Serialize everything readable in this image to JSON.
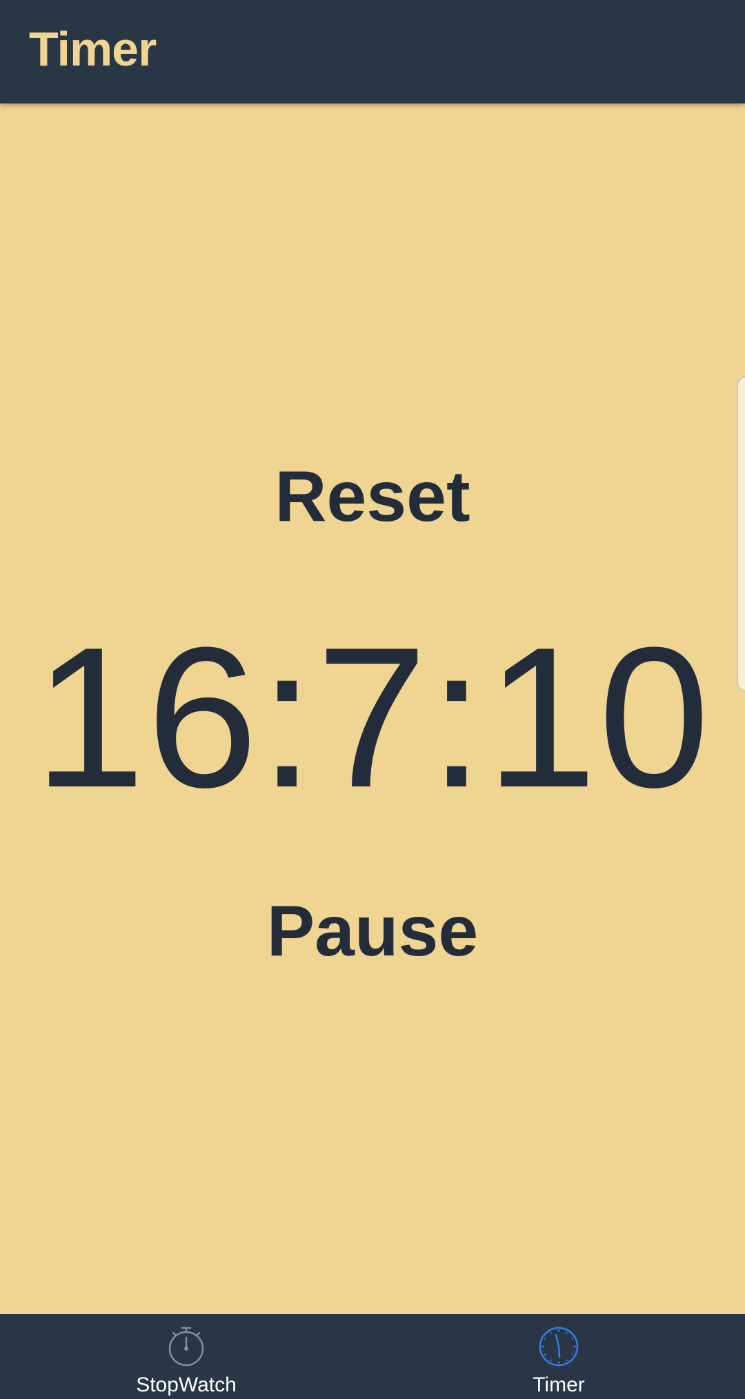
{
  "app_bar": {
    "title": "Timer",
    "background_color": "#283645",
    "title_color": "#f0d491"
  },
  "main": {
    "background_color": "#f0d491",
    "text_color": "#222c3a",
    "reset_label": "Reset",
    "time_display": "16:7:10",
    "pause_label": "Pause"
  },
  "bottom_nav": {
    "items": [
      {
        "label": "StopWatch",
        "icon": "stopwatch-icon",
        "active": false,
        "icon_color": "#8a8f96"
      },
      {
        "label": "Timer",
        "icon": "clock-icon",
        "active": true,
        "icon_color": "#3b7ee8"
      }
    ]
  }
}
